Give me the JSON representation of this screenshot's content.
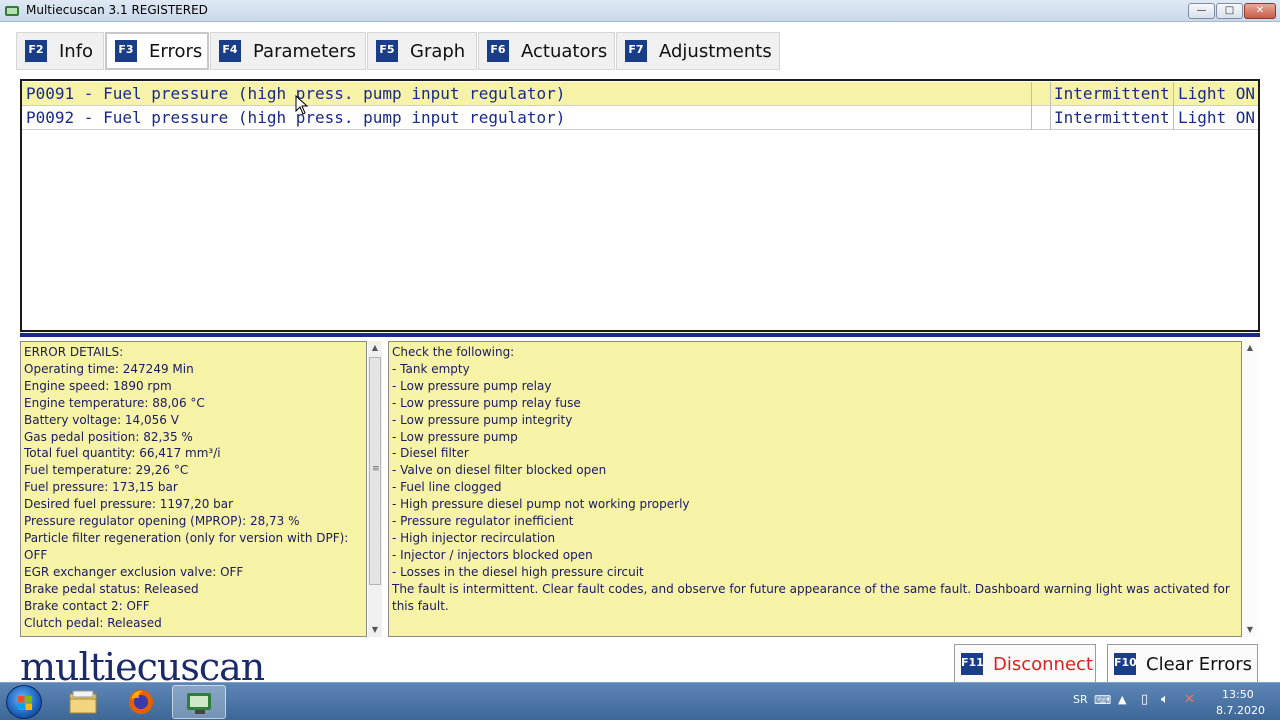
{
  "window": {
    "title": "Multiecuscan 3.1 REGISTERED",
    "controls": {
      "minimize": "—",
      "maximize": "□",
      "close": "✕"
    }
  },
  "tabs": [
    {
      "key": "F2",
      "label": "Info"
    },
    {
      "key": "F3",
      "label": "Errors",
      "active": true
    },
    {
      "key": "F4",
      "label": "Parameters"
    },
    {
      "key": "F5",
      "label": "Graph"
    },
    {
      "key": "F6",
      "label": "Actuators"
    },
    {
      "key": "F7",
      "label": "Adjustments"
    }
  ],
  "errors": [
    {
      "description": "P0091 - Fuel pressure (high press. pump input regulator)",
      "state": "Intermittent",
      "light": "Light ON",
      "selected": true
    },
    {
      "description": "P0092 - Fuel pressure (high press. pump input regulator)",
      "state": "Intermittent",
      "light": "Light ON",
      "selected": false
    }
  ],
  "details": [
    "ERROR DETAILS:",
    "Operating time: 247249 Min",
    "Engine speed: 1890 rpm",
    "Engine temperature: 88,06 °C",
    "Battery voltage: 14,056 V",
    "Gas pedal position: 82,35 %",
    "Total fuel quantity: 66,417 mm³/i",
    "Fuel temperature: 29,26 °C",
    "Fuel pressure: 173,15 bar",
    "Desired fuel pressure: 1197,20 bar",
    "Pressure regulator opening (MPROP): 28,73 %",
    "Particle filter regeneration (only for version with DPF):",
    "OFF",
    "EGR exchanger exclusion valve: OFF",
    "Brake pedal status: Released",
    "Brake contact 2: OFF",
    "Clutch pedal: Released"
  ],
  "advice": [
    "Check the following:",
    "- Tank empty",
    "- Low pressure pump relay",
    "- Low pressure pump relay fuse",
    "- Low pressure pump integrity",
    "- Low pressure pump",
    "- Diesel filter",
    "- Valve on diesel filter blocked open",
    "- Fuel line clogged",
    "- High pressure diesel pump not working properly",
    "- Pressure regulator inefficient",
    "- High injector recirculation",
    "- Injector / injectors blocked open",
    "- Losses in the diesel high pressure circuit",
    "The fault is intermittent. Clear fault codes, and observe for future appearance of the same fault. Dashboard warning light was activated for this fault."
  ],
  "logo": "multiecuscan",
  "buttons": {
    "disconnect": {
      "key": "F11",
      "label": "Disconnect"
    },
    "clear_errors": {
      "key": "F10",
      "label": "Clear Errors"
    }
  },
  "taskbar": {
    "language": "SR",
    "time": "13:50",
    "date": "8.7.2020"
  },
  "colors": {
    "accent": "#1a3d88",
    "panel_yellow": "#f6f3a7",
    "error_text": "#1a2a8a",
    "disconnect_red": "#e02020"
  }
}
